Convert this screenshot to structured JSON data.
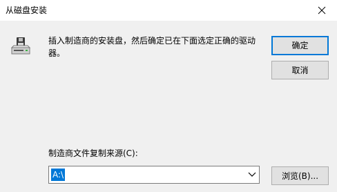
{
  "window": {
    "title": "从磁盘安装"
  },
  "icons": {
    "close": "close-icon",
    "disk": "disk-drive-icon",
    "dropdown": "chevron-down-icon"
  },
  "message": "插入制造商的安装盘，然后确定已在下面选定正确的驱动器。",
  "buttons": {
    "ok": "确定",
    "cancel": "取消",
    "browse": "浏览(B)..."
  },
  "source": {
    "label": "制造商文件复制来源(C):",
    "value": "A:\\"
  },
  "colors": {
    "accent": "#0078d7",
    "window_bg": "#f0f0f0",
    "button_bg": "#e1e1e1"
  }
}
